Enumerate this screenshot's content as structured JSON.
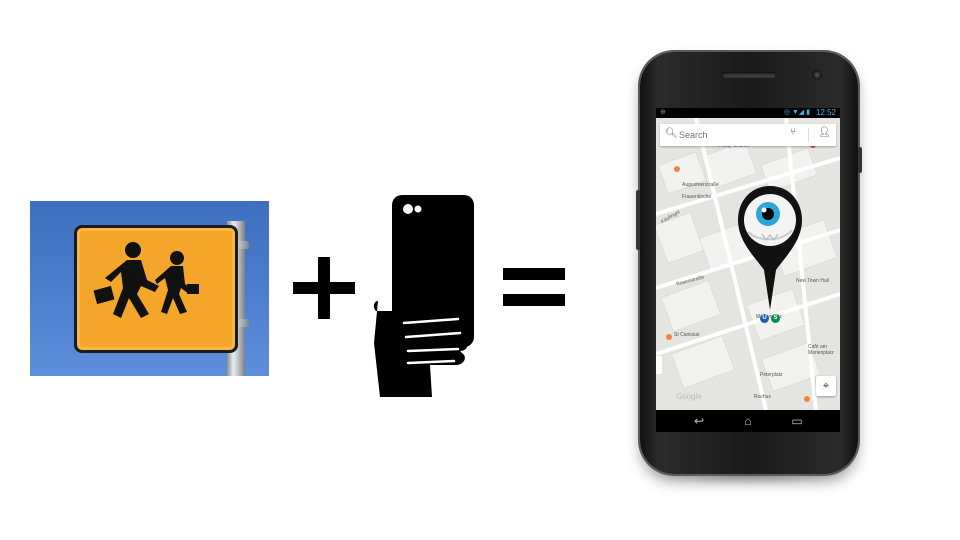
{
  "equation": {
    "operator_plus": "+",
    "operator_equals": "="
  },
  "sign_photo": {
    "subject": "school crossing sign",
    "colors": {
      "sky": "#4d7fcf",
      "sign": "#f4a62a",
      "border": "#1b1b1b"
    }
  },
  "hand_phone_icon": {
    "icon": "hand-holding-phone-icon"
  },
  "phone": {
    "status_bar": {
      "time": "12:52"
    },
    "search": {
      "placeholder": "Search"
    },
    "map": {
      "labels": [
        "Trinity Church",
        "Augusteerstraße",
        "Frauenkirche",
        "Kaufinger",
        "Marienplatz",
        "Rosenstraße",
        "St Canisius",
        "New Town Hall",
        "Café am Marienplatz",
        "Rochus",
        "Peterplatz"
      ],
      "google_logo": "Google"
    },
    "nav": {
      "back": "↩",
      "home": "⌂",
      "recent": "▭"
    }
  },
  "colors": {
    "pin_black": "#111111",
    "eye_blue": "#2aa7d8",
    "transit_u": "#1f5fae",
    "transit_s": "#0d8a4a"
  }
}
